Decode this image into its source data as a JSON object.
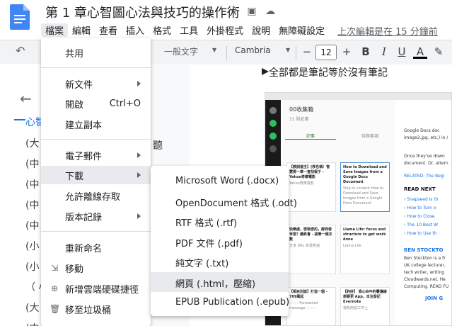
{
  "header": {
    "doc_title": "第 1 章心智圖心法與技巧的操作術",
    "last_edit": "上次編輯是在 15 分鐘前"
  },
  "menubar": [
    "檔案",
    "編輯",
    "查看",
    "插入",
    "格式",
    "工具",
    "外掛程式",
    "說明",
    "無障礙設定"
  ],
  "toolbar": {
    "style": "一般文字",
    "font": "Cambria",
    "font_size": "12",
    "minus": "−",
    "plus": "+",
    "bold": "B",
    "italic": "I",
    "underline": "U",
    "text_color": "A"
  },
  "file_menu": {
    "share": "共用",
    "new": "新文件",
    "open": "開啟",
    "open_shortcut": "Ctrl+O",
    "copy": "建立副本",
    "email": "電子郵件",
    "download": "下載",
    "offline": "允許離線存取",
    "version": "版本記錄",
    "rename": "重新命名",
    "move": "移動",
    "shortcut": "新增雲端硬碟捷徑",
    "trash": "移至垃圾桶"
  },
  "download_menu": [
    "Microsoft Word (.docx)",
    "OpenDocument 格式 (.odt)",
    "RTF 格式 (.rtf)",
    "PDF 文件 (.pdf)",
    "純文字 (.txt)",
    "網頁 (.html，壓縮)",
    "EPUB Publication (.epub)"
  ],
  "outline": {
    "first": "心智",
    "items": [
      "(大",
      "(中",
      "(中",
      "(中",
      "(中",
      "(小",
      "(小",
      "（ 小",
      "(大",
      "(中"
    ]
  },
  "doc": {
    "top_text": "全部都是筆記等於沒有筆記",
    "side_glyph": "聽"
  },
  "screenshot": {
    "notebook": "00收集箱",
    "count": "31 則記事",
    "tab1": "記事",
    "tab2": "待辦事項",
    "cards": [
      {
        "title": "【教訓值主】(移名稱）智慧要一章一查找報子 - Yahoo奇摩電影",
        "body": "Yahoo奇摩電影"
      },
      {
        "title": "How to Download and Save Images from a Google Docs Document",
        "body": "Skip to content How to Download and Save Images from a Google Docs Document"
      },
      {
        "title": "快樂處，密吸密的，薛西卷世第？最終會 - 該筆一頭次數",
        "body": "分享 URL 有發表過"
      },
      {
        "title": "Llama Life: focus and structure to get work done",
        "body": "Llama Life"
      },
      {
        "title": "【相目別誌】打造一個 - 709萬起",
        "body": "------- Forwarded message -------"
      },
      {
        "title": "【約好】 我心目中的賽邊線想要更 App，本注發記 Evernote",
        "body": "我有用過工作上"
      }
    ],
    "note_lines": [
      "Google Docs doc",
      "image2.jpg, etc.) in /",
      "Once they've down",
      "document. Or, altern",
      "RELATED: The Begi",
      "READ NEXT",
      "› Snapseed is th",
      "› How to Turn o",
      "› How to Close",
      "› The 10 Best W",
      "› How to Use th",
      "BEN STOCKTO",
      "Ben Stockton is a fr",
      "UK college lecturer,",
      "tech writer, writing",
      "Cloudwards.net. He",
      "Computing. READ FU",
      "JOIN G"
    ]
  }
}
